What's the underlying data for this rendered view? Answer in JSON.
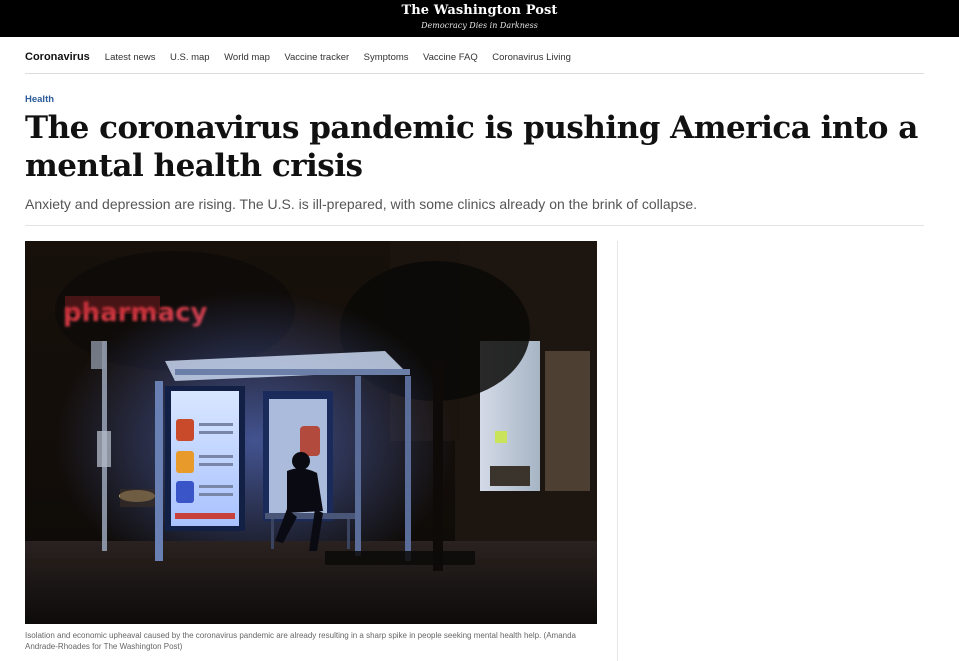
{
  "masthead": {
    "name": "The Washington Post",
    "tagline": "Democracy Dies in Darkness"
  },
  "subnav": {
    "home": "Coronavirus",
    "links": [
      "Latest news",
      "U.S. map",
      "World map",
      "Vaccine tracker",
      "Symptoms",
      "Vaccine FAQ",
      "Coronavirus Living"
    ]
  },
  "article": {
    "section": "Health",
    "headline": "The coronavirus pandemic is pushing America into a mental health crisis",
    "dek": "Anxiety and depression are rising. The U.S. is ill-prepared, with some clinics already on the brink of collapse.",
    "image": {
      "sign_text": "pharmacy",
      "caption": "Isolation and economic upheaval caused by the coronavirus pandemic are already resulting in a sharp spike in people seeking mental health help. (Amanda Andrade-Rhoades for The Washington Post)"
    }
  },
  "colors": {
    "masthead_bg": "#000000",
    "kicker": "#2a5c9a",
    "sign_glow": "#e8404a"
  }
}
